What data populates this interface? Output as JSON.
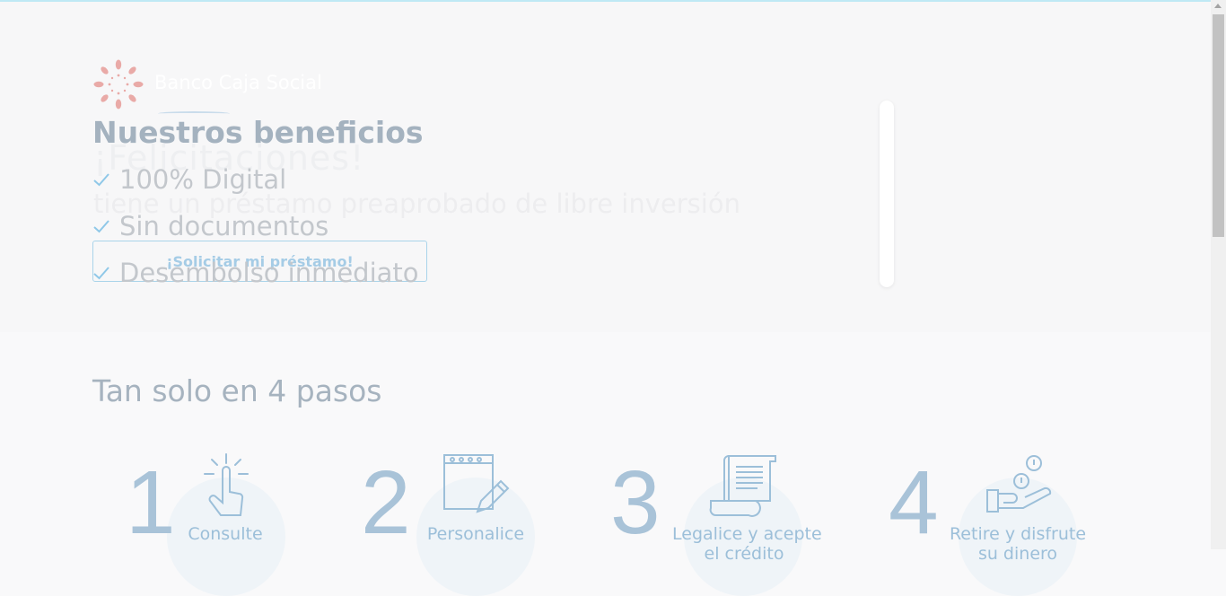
{
  "brand": {
    "name": "Banco Caja Social",
    "logo_color": "#e9aaa7"
  },
  "hero": {
    "ghost_title": "¡Felicitaciones!",
    "ghost_subtitle": "tiene un préstamo preaprobado de libre inversión",
    "cta_label": "¡Solicitar mi préstamo!"
  },
  "benefits": {
    "title": "Nuestros beneficios",
    "items": [
      "100% Digital",
      "Sin documentos",
      "Desembolso inmediato"
    ]
  },
  "steps": {
    "title": "Tan solo en 4 pasos",
    "items": [
      {
        "number": "1",
        "label": "Consulte",
        "label2": "",
        "icon": "tap-finger-icon"
      },
      {
        "number": "2",
        "label": "Personalice",
        "label2": "",
        "icon": "notepad-pencil-icon"
      },
      {
        "number": "3",
        "label": "Legalice y acepte",
        "label2": "el crédito",
        "icon": "document-scroll-icon"
      },
      {
        "number": "4",
        "label": "Retire y disfrute",
        "label2": "su dinero",
        "icon": "hand-coins-icon"
      }
    ]
  },
  "colors": {
    "accent": "#a9d4ea",
    "check": "#8fc8e8",
    "step_number": "#a9c3d8"
  }
}
